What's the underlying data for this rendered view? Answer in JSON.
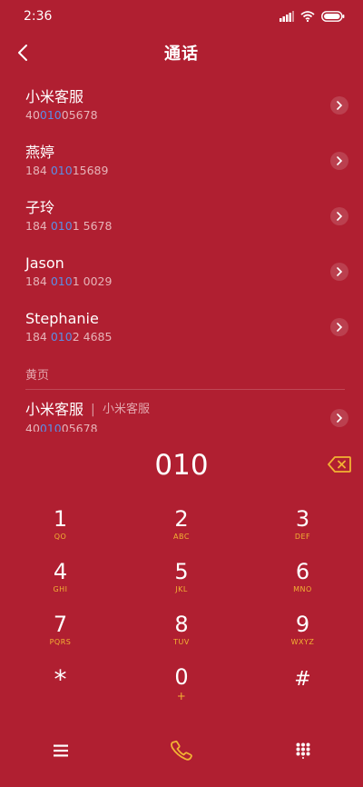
{
  "status_bar": {
    "time": "2:36"
  },
  "header": {
    "title": "通话"
  },
  "contacts": [
    {
      "name": "小米客服",
      "number_pre": "40",
      "number_hl": "010",
      "number_post": "05678"
    },
    {
      "name": "燕婷",
      "number_pre": "184 ",
      "number_hl": "010",
      "number_post": "15689"
    },
    {
      "name": "子玲",
      "number_pre": "184 ",
      "number_hl": "010",
      "number_post": "1 5678"
    },
    {
      "name": "Jason",
      "number_pre": "184 ",
      "number_hl": "010",
      "number_post": "1 0029"
    },
    {
      "name": "Stephanie",
      "number_pre": "184 ",
      "number_hl": "010",
      "number_post": "2 4685"
    }
  ],
  "yellow_pages": {
    "label": "黄页",
    "entry": {
      "name": "小米客服",
      "separator": "|",
      "subtitle": "小米客服",
      "number_pre": "40",
      "number_hl": "010",
      "number_post": "05678"
    }
  },
  "dial": {
    "input": "010"
  },
  "keypad": [
    {
      "digit": "1",
      "sub": "QO"
    },
    {
      "digit": "2",
      "sub": "ABC"
    },
    {
      "digit": "3",
      "sub": "DEF"
    },
    {
      "digit": "4",
      "sub": "GHI"
    },
    {
      "digit": "5",
      "sub": "JKL"
    },
    {
      "digit": "6",
      "sub": "MNO"
    },
    {
      "digit": "7",
      "sub": "PQRS"
    },
    {
      "digit": "8",
      "sub": "TUV"
    },
    {
      "digit": "9",
      "sub": "WXYZ"
    },
    {
      "digit": "*",
      "sub": ""
    },
    {
      "digit": "0",
      "sub": "+"
    },
    {
      "digit": "#",
      "sub": ""
    }
  ],
  "colors": {
    "background": "#b01f31",
    "highlight": "#5a8ee6",
    "accent": "#f2b233"
  },
  "icons": {
    "back": "chevron-left-icon",
    "backspace": "backspace-icon",
    "menu": "menu-icon",
    "call": "phone-icon",
    "dialpad": "dialpad-icon"
  }
}
